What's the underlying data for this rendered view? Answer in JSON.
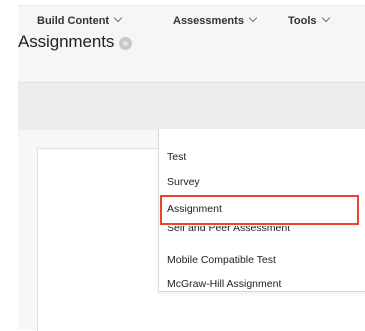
{
  "header": {
    "title": "Assignments"
  },
  "toolbar": {
    "items": [
      {
        "label": "Build Content"
      },
      {
        "label": "Assessments"
      },
      {
        "label": "Tools"
      }
    ]
  },
  "assessments_menu": {
    "items": [
      {
        "label": "Test"
      },
      {
        "label": "Survey"
      },
      {
        "label": "Assignment",
        "highlighted": true
      },
      {
        "label": "Self and Peer Assessment"
      },
      {
        "label": "Mobile Compatible Test"
      },
      {
        "label": "McGraw-Hill Assignment"
      }
    ]
  },
  "colors": {
    "highlight_border": "#e8442f"
  }
}
